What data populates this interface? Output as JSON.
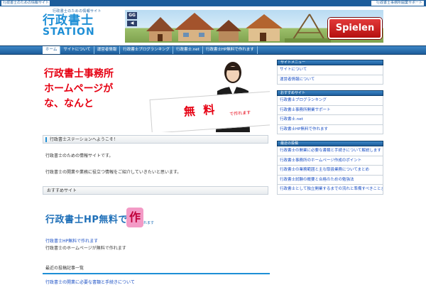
{
  "topbar": {
    "left_text": "行政書士のための情報サイト",
    "right_text": "行政書士事務所開業サポート"
  },
  "header": {
    "logo_tagline": "行政書士のための情報サイト",
    "logo_name_line1": "行政書士",
    "logo_name_line2": "STATION",
    "banner": {
      "badge": "GG",
      "arrow": "◀",
      "button_label": "Spielen"
    }
  },
  "nav": {
    "items": [
      {
        "label": "ホーム",
        "active": true
      },
      {
        "label": "サイトについて",
        "active": false
      },
      {
        "label": "運営者情報",
        "active": false
      },
      {
        "label": "行政書士ブログランキング",
        "active": false
      },
      {
        "label": "行政書士.net",
        "active": false
      },
      {
        "label": "行政書士HP無料で作れます",
        "active": false
      }
    ]
  },
  "hero": {
    "copy_line1": "行政書士事務所",
    "copy_line2": "ホームページが",
    "copy_line3": "な、なんと",
    "sign_big": "無 料",
    "sign_small": "で作れます"
  },
  "main": {
    "section1_title": "行政書士ステーションへようこそ！",
    "para1": "行政書士のための情報サイトです。",
    "para2": "行政書士の開業や業務に役立つ情報をご紹介していきたいと思います。",
    "section2_title": "おすすめサイト",
    "hplogo_text": "行政書士HP無料で作",
    "hplogo_mark": "作",
    "hplogo_sub": "れます",
    "link1": "行政書士HP無料で作れます",
    "desc1": "行政書士のホームページが無料で作れます",
    "footer_title": "最近の投稿記事一覧",
    "footer_link": "行政書士の開業に必要な書類と手続きについて"
  },
  "sidebar": {
    "box1": {
      "title": "サイトメニュー",
      "items": [
        "サイトについて",
        "運営者情報について"
      ]
    },
    "box2": {
      "title": "おすすめサイト",
      "items": [
        "行政書士ブログランキング",
        "行政書士事務所開業サポート",
        "行政書士.net",
        "行政書士HP無料で作れます"
      ]
    },
    "box3": {
      "title": "最近の投稿",
      "items": [
        "行政書士の開業に必要な書類と手続きについて解説します",
        "行政書士事務所のホームページ作成のポイント",
        "行政書士の業務範囲と主な取扱業務についてまとめ",
        "行政書士試験の概要と合格のための勉強法",
        "行政書士として独立開業するまでの流れと準備すべきことまとめ"
      ]
    }
  },
  "colors": {
    "brand_blue": "#1d5d9b",
    "accent_red": "#e60012",
    "link_blue": "#1a4fc4"
  }
}
